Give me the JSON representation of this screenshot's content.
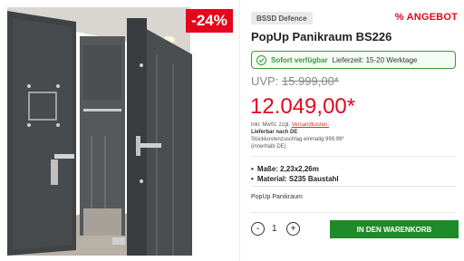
{
  "image": {
    "discount_badge": "-24%"
  },
  "product": {
    "brand": "BSSD Defence",
    "sale_label": "% ANGEBOT",
    "title": "PopUp Panikraum BS226",
    "availability": {
      "status": "Sofort verfügbar",
      "delivery": "Lieferzeit: 15-20 Werktage"
    },
    "uvp_label": "UVP:",
    "uvp_price": "15.999,00*",
    "price": "12.049,00*",
    "tax": {
      "line1_prefix": "inkl. MwSt. zzgl.",
      "shipping_link": "Versandkosten:",
      "line2": "Lieferbar nach DE",
      "line3": "Stückkostenzuschlag einmalig 999,99*",
      "line4": "(innerhalb DE)"
    },
    "features": [
      "Maße: 2,23x2,26m",
      "Material: S235 Baustahl"
    ],
    "short_description": "PopUp Panikraum"
  },
  "cart": {
    "minus": "-",
    "quantity": "1",
    "plus": "+",
    "button_label": "IN DEN WARENKORB"
  },
  "colors": {
    "accent_red": "#e3061c",
    "cart_green": "#1f8a2a",
    "availability_green": "#3a9b3a"
  }
}
